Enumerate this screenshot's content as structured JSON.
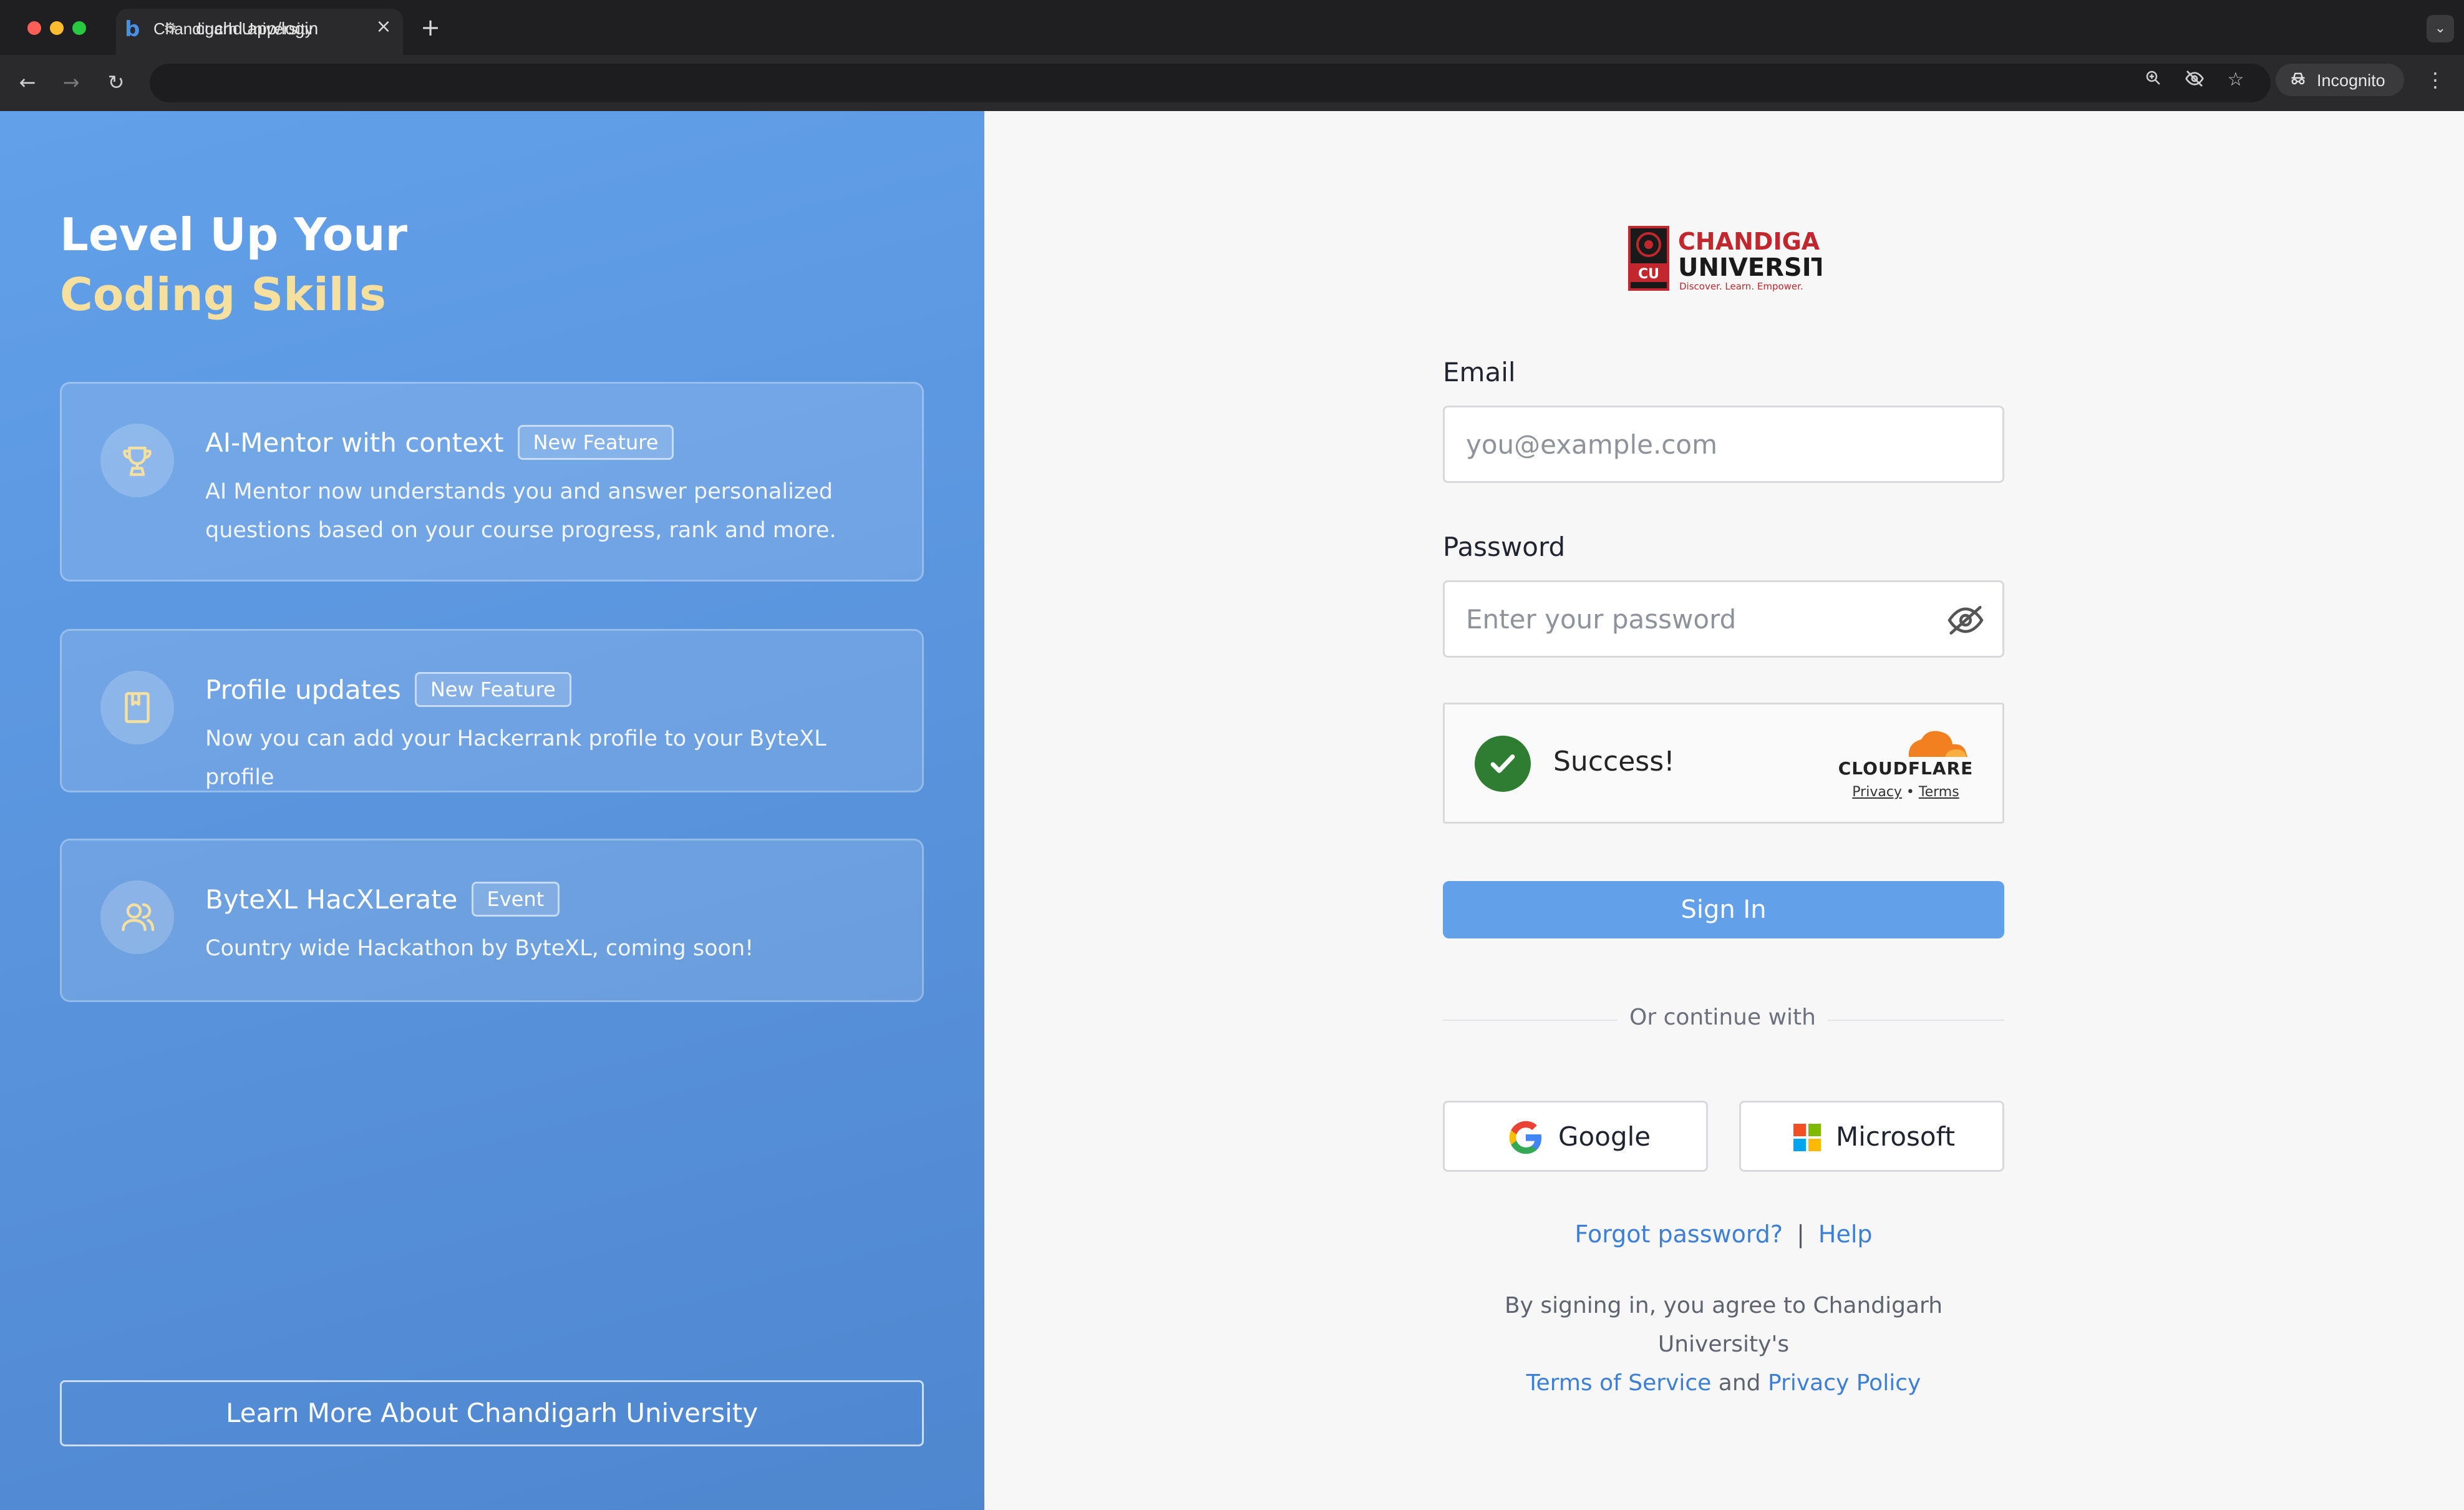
{
  "browser": {
    "tab_title": "Chandigarh University",
    "url": "cuchd.app/login",
    "incognito_label": "Incognito",
    "favicon": "b"
  },
  "hero": {
    "line1": "Level Up Your",
    "line2": "Coding Skills"
  },
  "features": [
    {
      "title": "AI-Mentor with context",
      "badge": "New Feature",
      "description": "AI Mentor now understands you and answer personalized questions based on your course progress, rank and more.",
      "icon": "trophy-icon"
    },
    {
      "title": "Profile updates",
      "badge": "New Feature",
      "description": "Now you can add your Hackerrank profile to your ByteXL profile",
      "icon": "bookmark-icon"
    },
    {
      "title": "ByteXL HacXLerate",
      "badge": "Event",
      "description": "Country wide Hackathon by ByteXL, coming soon!",
      "icon": "users-icon"
    }
  ],
  "learn_more_label": "Learn More About Chandigarh University",
  "logo": {
    "line1": "CHANDIGARH",
    "line2": "UNIVERSITY",
    "tagline": "Discover. Learn. Empower.",
    "badge": "CU"
  },
  "form": {
    "email_label": "Email",
    "email_placeholder": "you@example.com",
    "password_label": "Password",
    "password_placeholder": "Enter your password",
    "captcha_status": "Success!",
    "captcha_brand": "CLOUDFLARE",
    "captcha_privacy": "Privacy",
    "captcha_terms": "Terms",
    "signin_label": "Sign In",
    "divider_text": "Or continue with",
    "google_label": "Google",
    "microsoft_label": "Microsoft",
    "forgot_label": "Forgot password?",
    "help_label": "Help",
    "terms_prefix": "By signing in, you agree to Chandigarh University's",
    "terms_link": "Terms of Service",
    "terms_and": "and",
    "privacy_link": "Privacy Policy"
  },
  "colors": {
    "accent": "#62a0ea",
    "link": "#3c7fd6",
    "hero_highlight": "#f5e0a0",
    "brand_red": "#c1272d",
    "success_green": "#2e7d32"
  }
}
